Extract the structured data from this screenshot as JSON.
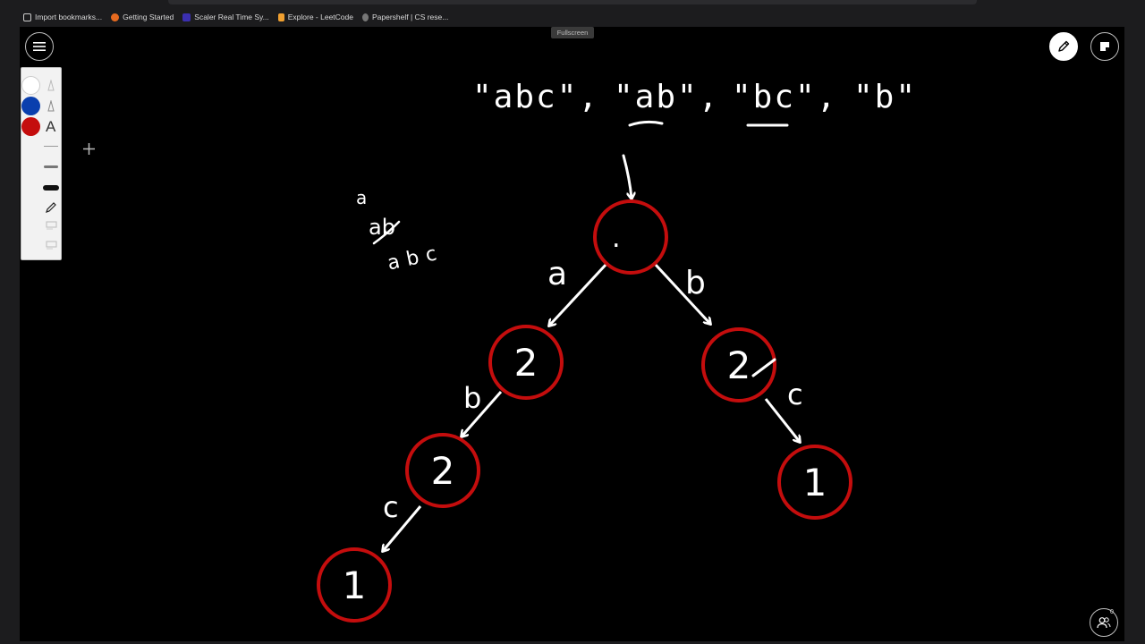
{
  "browser": {
    "bookmarks": [
      {
        "label": "Import bookmarks...",
        "icon": "import-icon"
      },
      {
        "label": "Getting Started",
        "icon": "firefox-icon"
      },
      {
        "label": "Scaler Real Time Sy...",
        "icon": "scaler-icon"
      },
      {
        "label": "Explore - LeetCode",
        "icon": "leetcode-icon"
      },
      {
        "label": "Papershelf | CS rese...",
        "icon": "papershelf-icon"
      }
    ],
    "fullscreen_tooltip": "Fullscreen"
  },
  "toolbar": {
    "colors": [
      "#ffffff",
      "#0a3fae",
      "#c40d0d"
    ],
    "text_tool_label": "A"
  },
  "board": {
    "strings": [
      "\"abc\",",
      "\"ab\",",
      "\"bc\",",
      "\"b\""
    ],
    "notes": [
      "a",
      "ab",
      "abc"
    ],
    "root_label": ".",
    "edge_labels": [
      "a",
      "b",
      "b",
      "c",
      "c"
    ],
    "node_counts": [
      "2",
      "2",
      "2",
      "1",
      "1"
    ],
    "node_color": "#c40d0d"
  },
  "users": {
    "count": "0"
  }
}
